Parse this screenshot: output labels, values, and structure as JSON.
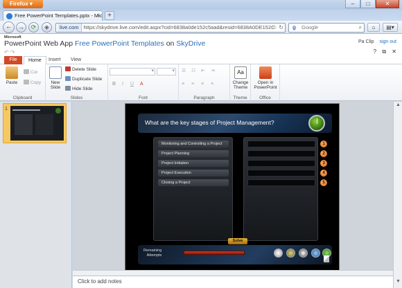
{
  "browser": {
    "menu_label": "Firefox",
    "tab_title": "Free PowerPoint Templates.pptx - Micro...",
    "url_identity": "live.com",
    "url_text": "https://skydrive.live.com/edit.aspx?cid=6838a0de152c5aad&resid=6838A0DE152C",
    "search_placeholder": "Google",
    "search_engine_letter": "g"
  },
  "app": {
    "vendor": "Microsoft",
    "name": "PowerPoint Web App",
    "document": "Free PowerPoint Templates",
    "on_word": "on",
    "service": "SkyDrive",
    "user": "Pa Clip",
    "signout": "sign out"
  },
  "ribbon": {
    "tabs": [
      "File",
      "Home",
      "Insert",
      "View"
    ],
    "clipboard": {
      "paste": "Paste",
      "cut": "Cut",
      "copy": "Copy",
      "label": "Clipboard"
    },
    "slides": {
      "new_slide_1": "New",
      "new_slide_2": "Slide",
      "delete": "Delete Slide",
      "duplicate": "Duplicate Slide",
      "hide": "Hide Slide",
      "label": "Slides"
    },
    "font": {
      "bold": "B",
      "italic": "I",
      "underline": "U",
      "color": "A",
      "label": "Font"
    },
    "paragraph": {
      "label": "Paragraph"
    },
    "theme": {
      "change_1": "Change",
      "change_2": "Theme",
      "label": "Theme"
    },
    "office": {
      "open_1": "Open in",
      "open_2": "PowerPoint",
      "label": "Office"
    },
    "theme_icon_text": "Aa"
  },
  "thumbnails": {
    "slide_number": "1"
  },
  "slide": {
    "title": "What are the key stages of Project Management?",
    "items": [
      "Monitoring and Controlling a Project",
      "Project Planning",
      "Project Initiation",
      "Project Execution",
      "Closing a Project"
    ],
    "numbers": [
      "1",
      "2",
      "3",
      "4",
      "5"
    ],
    "solve": "Solve",
    "remaining_1": "Remaining",
    "remaining_2": "Attempts"
  },
  "notes": {
    "placeholder": "Click to add notes"
  },
  "colors": {
    "accent_orange": "#d24726",
    "skydrive_blue": "#2a6fb8",
    "thumb_highlight": "#f6c85f"
  }
}
